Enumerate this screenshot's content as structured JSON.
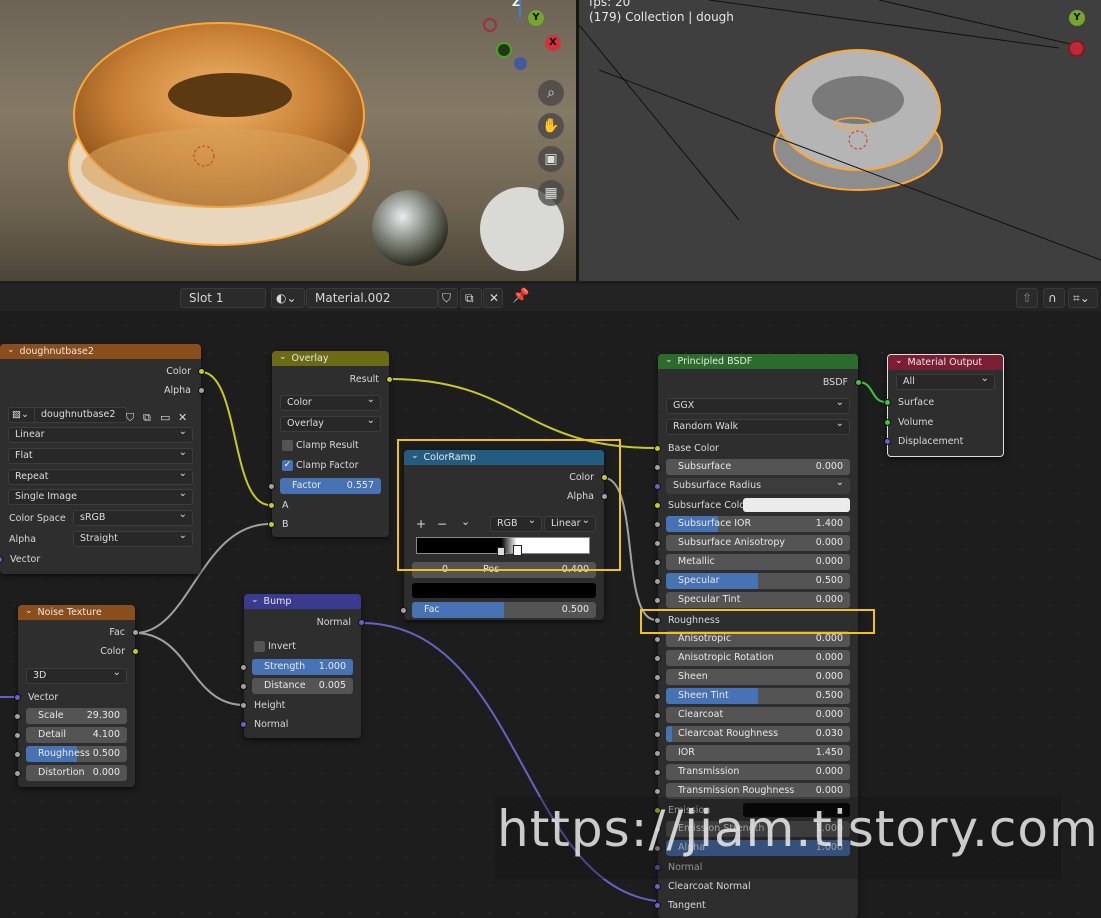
{
  "viewport_right": {
    "fps_text": "fps: 20",
    "collection_text": "(179) Collection | dough"
  },
  "gizmo": {
    "z": "Z",
    "y": "Y",
    "x": "X"
  },
  "header": {
    "slot": "Slot 1",
    "material": "Material.002"
  },
  "nodes": {
    "image": {
      "title": "doughnutbase2",
      "out_color": "Color",
      "out_alpha": "Alpha",
      "image_name": "doughnutbase2",
      "interp": "Linear",
      "proj": "Flat",
      "ext": "Repeat",
      "source": "Single Image",
      "cs_label": "Color Space",
      "cs_value": "sRGB",
      "alpha_label": "Alpha",
      "alpha_value": "Straight",
      "vector": "Vector"
    },
    "overlay": {
      "title": "Overlay",
      "result": "Result",
      "mode1": "Color",
      "mode2": "Overlay",
      "clamp_result": "Clamp Result",
      "clamp_factor": "Clamp Factor",
      "factor_label": "Factor",
      "factor_value": "0.557",
      "a": "A",
      "b": "B"
    },
    "colorramp": {
      "title": "ColorRamp",
      "out_color": "Color",
      "out_alpha": "Alpha",
      "plus": "+",
      "minus": "−",
      "chev": "⌄",
      "mode": "RGB",
      "interp": "Linear",
      "index": "0",
      "pos_label": "Pos",
      "pos_value": "0.400",
      "fac_label": "Fac",
      "fac_value": "0.500"
    },
    "noise": {
      "title": "Noise Texture",
      "fac": "Fac",
      "color": "Color",
      "dim": "3D",
      "vector": "Vector",
      "scale_label": "Scale",
      "scale_value": "29.300",
      "detail_label": "Detail",
      "detail_value": "4.100",
      "rough_label": "Roughness",
      "rough_value": "0.500",
      "dist_label": "Distortion",
      "dist_value": "0.000"
    },
    "bump": {
      "title": "Bump",
      "normal_out": "Normal",
      "invert": "Invert",
      "strength_label": "Strength",
      "strength_value": "1.000",
      "distance_label": "Distance",
      "distance_value": "0.005",
      "height": "Height",
      "normal_in": "Normal"
    },
    "bsdf": {
      "title": "Principled BSDF",
      "out": "BSDF",
      "dist": "GGX",
      "sss_method": "Random Walk",
      "base_color": "Base Color",
      "subsurface_label": "Subsurface",
      "subsurface_value": "0.000",
      "subsurface_radius": "Subsurface Radius",
      "subsurface_color": "Subsurface Color",
      "sss_ior_label": "Subsurface IOR",
      "sss_ior_value": "1.400",
      "sss_aniso_label": "Subsurface Anisotropy",
      "sss_aniso_value": "0.000",
      "metallic_label": "Metallic",
      "metallic_value": "0.000",
      "specular_label": "Specular",
      "specular_value": "0.500",
      "spec_tint_label": "Specular Tint",
      "spec_tint_value": "0.000",
      "roughness": "Roughness",
      "aniso_label": "Anisotropic",
      "aniso_value": "0.000",
      "aniso_rot_label": "Anisotropic Rotation",
      "aniso_rot_value": "0.000",
      "sheen_label": "Sheen",
      "sheen_value": "0.000",
      "sheen_tint_label": "Sheen Tint",
      "sheen_tint_value": "0.500",
      "clearcoat_label": "Clearcoat",
      "clearcoat_value": "0.000",
      "cc_rough_label": "Clearcoat Roughness",
      "cc_rough_value": "0.030",
      "ior_label": "IOR",
      "ior_value": "1.450",
      "trans_label": "Transmission",
      "trans_value": "0.000",
      "trans_rough_label": "Transmission Roughness",
      "trans_rough_value": "0.000",
      "emission": "Emission",
      "em_strength_label": "Emission Strength",
      "em_strength_value": "1.000",
      "alpha_label": "Alpha",
      "alpha_value": "1.000",
      "normal": "Normal",
      "cc_normal": "Clearcoat Normal",
      "tangent": "Tangent"
    },
    "output": {
      "title": "Material Output",
      "target": "All",
      "surface": "Surface",
      "volume": "Volume",
      "displacement": "Displacement"
    }
  },
  "watermark": "https://jiam.tistory.com",
  "colors": {
    "texture_header": "#8a4d1c",
    "color_header": "#6b6b16",
    "converter_header": "#245c80",
    "vector_header": "#3a3a8f",
    "shader_header": "#2b6b2b",
    "output_header": "#7a1f33",
    "highlight": "#f1c21b",
    "selection": "#ffa733"
  }
}
